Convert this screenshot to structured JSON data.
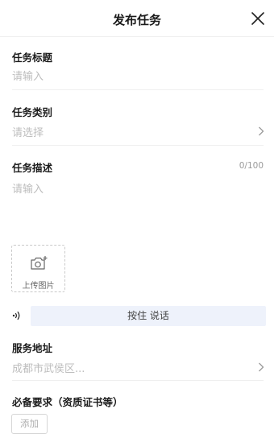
{
  "header": {
    "title": "发布任务",
    "close_icon": "close-icon"
  },
  "title_field": {
    "label": "任务标题",
    "placeholder": "请输入"
  },
  "category_field": {
    "label": "任务类别",
    "placeholder": "请选择",
    "icon": "chevron-right-icon"
  },
  "description_field": {
    "label": "任务描述",
    "counter": "0/100",
    "placeholder": "请输入"
  },
  "upload": {
    "label": "上传图片",
    "icon": "camera-add-icon"
  },
  "voice": {
    "button_label": "按住 说话",
    "icon": "voice-wave-icon",
    "bg_color": "#eef2fb"
  },
  "address_field": {
    "label": "服务地址",
    "placeholder": "成都市武侯区...",
    "icon": "chevron-right-icon"
  },
  "requirements": {
    "label": "必备要求（资质证书等）",
    "add_label": "添加"
  }
}
